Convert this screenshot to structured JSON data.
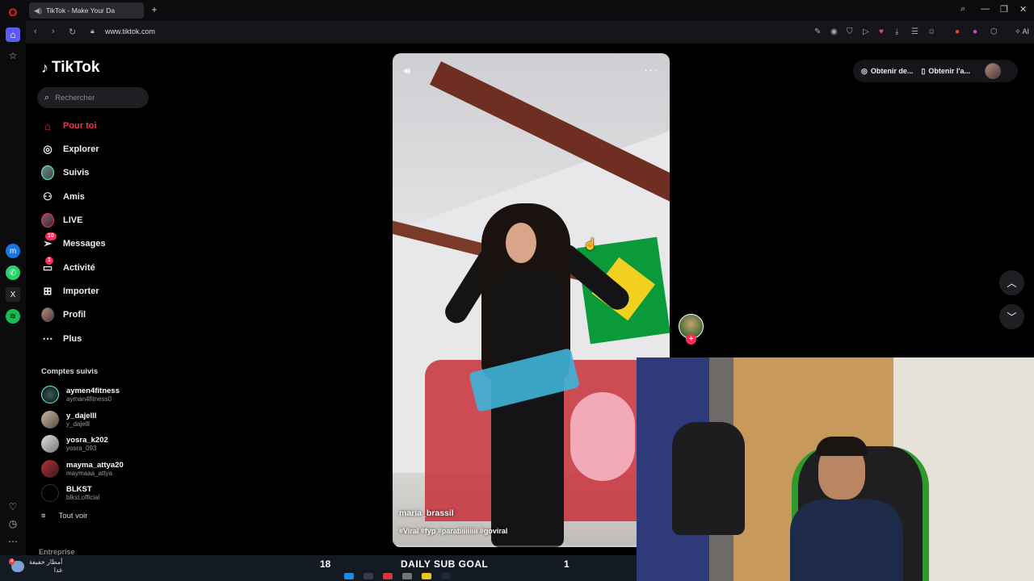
{
  "browser": {
    "tab_title": "TikTok - Make Your Da",
    "url": "www.tiktok.com",
    "ai_label": "AI"
  },
  "tiktok": {
    "logo_text": "TikTok",
    "search_placeholder": "Rechercher",
    "nav": [
      {
        "label": "Pour toi",
        "icon": "home-icon",
        "active": true
      },
      {
        "label": "Explorer",
        "icon": "compass-icon"
      },
      {
        "label": "Suivis",
        "icon": "avatar-icon"
      },
      {
        "label": "Amis",
        "icon": "friends-icon"
      },
      {
        "label": "LIVE",
        "icon": "live-icon"
      },
      {
        "label": "Messages",
        "icon": "send-icon",
        "badge": "10"
      },
      {
        "label": "Activité",
        "icon": "inbox-icon",
        "badge": "1"
      },
      {
        "label": "Importer",
        "icon": "upload-icon"
      },
      {
        "label": "Profil",
        "icon": "profile-icon"
      },
      {
        "label": "Plus",
        "icon": "more-icon"
      }
    ],
    "followed_title": "Comptes suivis",
    "followed": [
      {
        "name": "aymen4fitness",
        "handle": "ayman4fitness0"
      },
      {
        "name": "y_dajelll",
        "handle": "y_dajelll"
      },
      {
        "name": "yosra_k202",
        "handle": "yosra_093"
      },
      {
        "name": "mayma_attya20",
        "handle": "maymaaa_attya"
      },
      {
        "name": "BLKST",
        "handle": "blkst.official"
      }
    ],
    "see_all": "Tout voir",
    "footer_label": "Entreprise",
    "top_buttons": {
      "get_coins": "Obtenir de...",
      "get_app": "Obtenir l'a..."
    },
    "video": {
      "username": "maria_brassil",
      "hashtags": "#Viral #fyp #paratiiiiiiiii #goviral",
      "progress": 0.02
    }
  },
  "overlay": {
    "sub_goal_current": "18",
    "sub_goal_title": "DAILY SUB GOAL",
    "sub_goal_right": "1",
    "weather_text": "أمطار خفيفة",
    "weather_sub": "غدا",
    "weather_badge": "4"
  }
}
